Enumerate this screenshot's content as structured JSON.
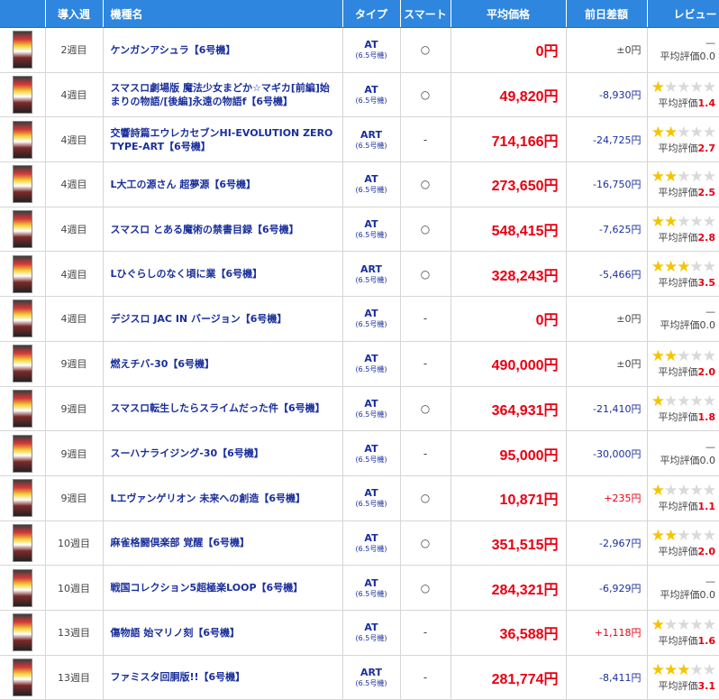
{
  "headers": {
    "week": "導入週",
    "name": "機種名",
    "type": "タイプ",
    "smart": "スマート",
    "price": "平均価格",
    "diff": "前日差額",
    "review": "レビュー"
  },
  "review_label": "平均評価",
  "type_sub": "(6.5号機)",
  "rows": [
    {
      "week": "2週目",
      "name": "ケンガンアシュラ【6号機】",
      "type": "AT",
      "smart": "○",
      "price": "0円",
      "diff": "±0円",
      "diff_kind": "zero",
      "rating": null,
      "rating_text": "0.0",
      "dash": "—"
    },
    {
      "week": "4週目",
      "name": "スマスロ劇場版 魔法少女まどか☆マギカ[前編]始まりの物語/[後編]永遠の物語f【6号機】",
      "type": "AT",
      "smart": "○",
      "price": "49,820円",
      "diff": "-8,930円",
      "diff_kind": "neg",
      "rating": 1.4,
      "rating_text": "1.4"
    },
    {
      "week": "4週目",
      "name": "交響詩篇エウレカセブンHI-EVOLUTION ZERO TYPE-ART【6号機】",
      "type": "ART",
      "smart": "-",
      "price": "714,166円",
      "diff": "-24,725円",
      "diff_kind": "neg",
      "rating": 2.7,
      "rating_text": "2.7"
    },
    {
      "week": "4週目",
      "name": "L大工の源さん 超夢源【6号機】",
      "type": "AT",
      "smart": "○",
      "price": "273,650円",
      "diff": "-16,750円",
      "diff_kind": "neg",
      "rating": 2.5,
      "rating_text": "2.5"
    },
    {
      "week": "4週目",
      "name": "スマスロ とある魔術の禁書目録【6号機】",
      "type": "AT",
      "smart": "○",
      "price": "548,415円",
      "diff": "-7,625円",
      "diff_kind": "neg",
      "rating": 2.8,
      "rating_text": "2.8"
    },
    {
      "week": "4週目",
      "name": "Lひぐらしのなく頃に業【6号機】",
      "type": "ART",
      "smart": "○",
      "price": "328,243円",
      "diff": "-5,466円",
      "diff_kind": "neg",
      "rating": 3.5,
      "rating_text": "3.5"
    },
    {
      "week": "4週目",
      "name": "デジスロ JAC IN バージョン【6号機】",
      "type": "AT",
      "smart": "-",
      "price": "0円",
      "diff": "±0円",
      "diff_kind": "zero",
      "rating": null,
      "rating_text": "0.0",
      "dash": "—"
    },
    {
      "week": "9週目",
      "name": "燃えチバ-30【6号機】",
      "type": "AT",
      "smart": "-",
      "price": "490,000円",
      "diff": "±0円",
      "diff_kind": "zero",
      "rating": 2.0,
      "rating_text": "2.0"
    },
    {
      "week": "9週目",
      "name": "スマスロ転生したらスライムだった件【6号機】",
      "type": "AT",
      "smart": "○",
      "price": "364,931円",
      "diff": "-21,410円",
      "diff_kind": "neg",
      "rating": 1.8,
      "rating_text": "1.8"
    },
    {
      "week": "9週目",
      "name": "スーハナライジング-30【6号機】",
      "type": "AT",
      "smart": "-",
      "price": "95,000円",
      "diff": "-30,000円",
      "diff_kind": "neg",
      "rating": null,
      "rating_text": "0.0",
      "dash": "—"
    },
    {
      "week": "9週目",
      "name": "Lエヴァンゲリオン 未来への創造【6号機】",
      "type": "AT",
      "smart": "○",
      "price": "10,871円",
      "diff": "+235円",
      "diff_kind": "pos",
      "rating": 1.1,
      "rating_text": "1.1"
    },
    {
      "week": "10週目",
      "name": "麻雀格闘倶楽部 覚醒【6号機】",
      "type": "AT",
      "smart": "○",
      "price": "351,515円",
      "diff": "-2,967円",
      "diff_kind": "neg",
      "rating": 2.0,
      "rating_text": "2.0"
    },
    {
      "week": "10週目",
      "name": "戦国コレクション5超極楽LOOP【6号機】",
      "type": "AT",
      "smart": "○",
      "price": "284,321円",
      "diff": "-6,929円",
      "diff_kind": "neg",
      "rating": null,
      "rating_text": "0.0",
      "dash": "—"
    },
    {
      "week": "13週目",
      "name": "傷物語 始マリノ刻【6号機】",
      "type": "AT",
      "smart": "-",
      "price": "36,588円",
      "diff": "+1,118円",
      "diff_kind": "pos",
      "rating": 1.6,
      "rating_text": "1.6"
    },
    {
      "week": "13週目",
      "name": "ファミスタ回胴版!!【6号機】",
      "type": "ART",
      "smart": "-",
      "price": "281,774円",
      "diff": "-8,411円",
      "diff_kind": "neg",
      "rating": 3.1,
      "rating_text": "3.1"
    }
  ]
}
